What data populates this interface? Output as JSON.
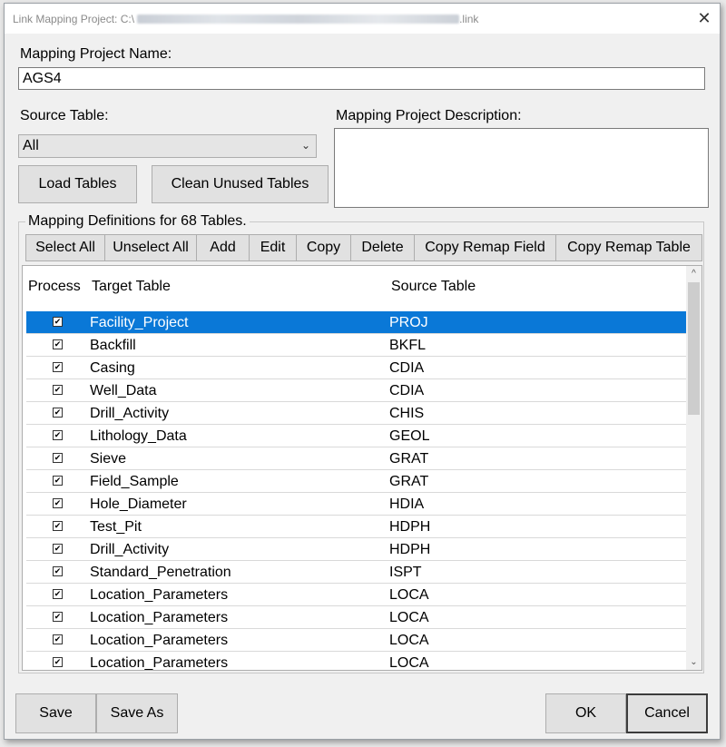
{
  "window": {
    "title": "Link Mapping Project: C:\\",
    "title_suffix": ".link"
  },
  "form": {
    "project_name_label": "Mapping Project Name:",
    "project_name_value": "AGS4",
    "source_table_label": "Source Table:",
    "source_table_value": "All",
    "description_label": "Mapping Project Description:",
    "description_value": "",
    "load_tables_label": "Load Tables",
    "clean_unused_label": "Clean Unused Tables"
  },
  "definitions": {
    "group_title": "Mapping Definitions for 68 Tables.",
    "toolbar": [
      "Select All",
      "Unselect All",
      "Add",
      "Edit",
      "Copy",
      "Delete",
      "Copy Remap Field",
      "Copy Remap Table"
    ],
    "columns": {
      "process": "Process",
      "target": "Target Table",
      "source": "Source Table"
    },
    "rows": [
      {
        "target": "Facility_Project",
        "source": "PROJ",
        "checked": true,
        "selected": true
      },
      {
        "target": "Backfill",
        "source": "BKFL",
        "checked": true
      },
      {
        "target": "Casing",
        "source": "CDIA",
        "checked": true
      },
      {
        "target": "Well_Data",
        "source": "CDIA",
        "checked": true
      },
      {
        "target": "Drill_Activity",
        "source": "CHIS",
        "checked": true
      },
      {
        "target": "Lithology_Data",
        "source": "GEOL",
        "checked": true
      },
      {
        "target": "Sieve",
        "source": "GRAT",
        "checked": true
      },
      {
        "target": "Field_Sample",
        "source": "GRAT",
        "checked": true
      },
      {
        "target": "Hole_Diameter",
        "source": "HDIA",
        "checked": true
      },
      {
        "target": "Test_Pit",
        "source": "HDPH",
        "checked": true
      },
      {
        "target": "Drill_Activity",
        "source": "HDPH",
        "checked": true
      },
      {
        "target": "Standard_Penetration",
        "source": "ISPT",
        "checked": true
      },
      {
        "target": "Location_Parameters",
        "source": "LOCA",
        "checked": true
      },
      {
        "target": "Location_Parameters",
        "source": "LOCA",
        "checked": true
      },
      {
        "target": "Location_Parameters",
        "source": "LOCA",
        "checked": true
      },
      {
        "target": "Location_Parameters",
        "source": "LOCA",
        "checked": true
      }
    ]
  },
  "footer": {
    "save_label": "Save",
    "save_as_label": "Save As",
    "ok_label": "OK",
    "cancel_label": "Cancel"
  },
  "colors": {
    "selection": "#0a78d7",
    "window_bg": "#f0f0f0"
  }
}
